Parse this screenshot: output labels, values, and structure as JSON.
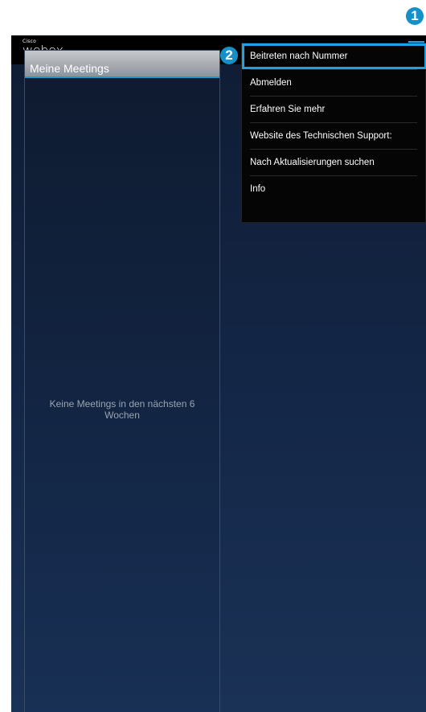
{
  "app": {
    "brand_small": "Cisco",
    "brand": "webex"
  },
  "toolbar": {
    "icons": [
      "new-window-icon",
      "refresh-icon",
      "overflow-menu-icon"
    ]
  },
  "panel": {
    "title": "Meine Meetings",
    "empty_message": "Keine Meetings in den nächsten 6 Wochen"
  },
  "menu": {
    "items": [
      {
        "label": "Beitreten nach Nummer",
        "highlighted": true
      },
      {
        "label": "Abmelden"
      },
      {
        "label": "Erfahren Sie mehr"
      },
      {
        "label": "Website des Technischen Support:"
      },
      {
        "label": "Nach Aktualisierungen suchen"
      },
      {
        "label": "Info"
      }
    ]
  },
  "callouts": [
    "1",
    "2"
  ],
  "colors": {
    "accent": "#1fa2e0",
    "callout": "#1690c8",
    "topbar": "#000000",
    "background": "#142748"
  }
}
